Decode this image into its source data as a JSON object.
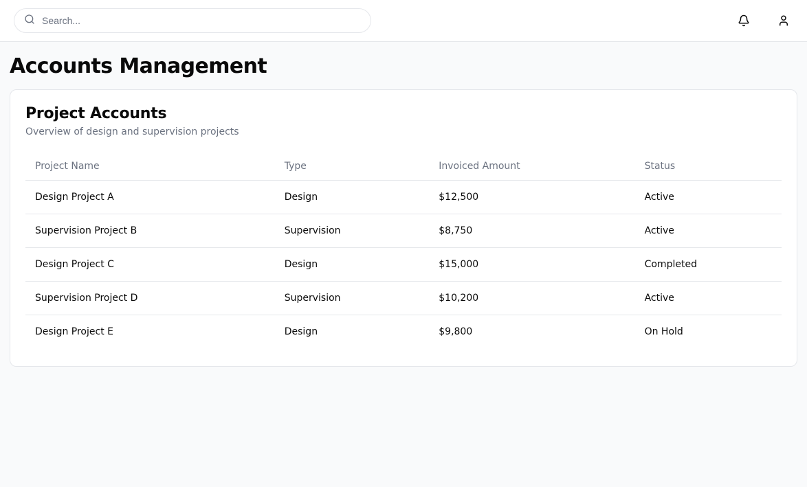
{
  "header": {
    "search_placeholder": "Search..."
  },
  "page": {
    "title": "Accounts Management"
  },
  "card": {
    "title": "Project Accounts",
    "subtitle": "Overview of design and supervision projects"
  },
  "table": {
    "columns": {
      "project": "Project Name",
      "type": "Type",
      "invoiced": "Invoiced Amount",
      "status": "Status"
    },
    "rows": [
      {
        "project": "Design Project A",
        "type": "Design",
        "invoiced": "$12,500",
        "status": "Active"
      },
      {
        "project": "Supervision Project B",
        "type": "Supervision",
        "invoiced": "$8,750",
        "status": "Active"
      },
      {
        "project": "Design Project C",
        "type": "Design",
        "invoiced": "$15,000",
        "status": "Completed"
      },
      {
        "project": "Supervision Project D",
        "type": "Supervision",
        "invoiced": "$10,200",
        "status": "Active"
      },
      {
        "project": "Design Project E",
        "type": "Design",
        "invoiced": "$9,800",
        "status": "On Hold"
      }
    ]
  }
}
